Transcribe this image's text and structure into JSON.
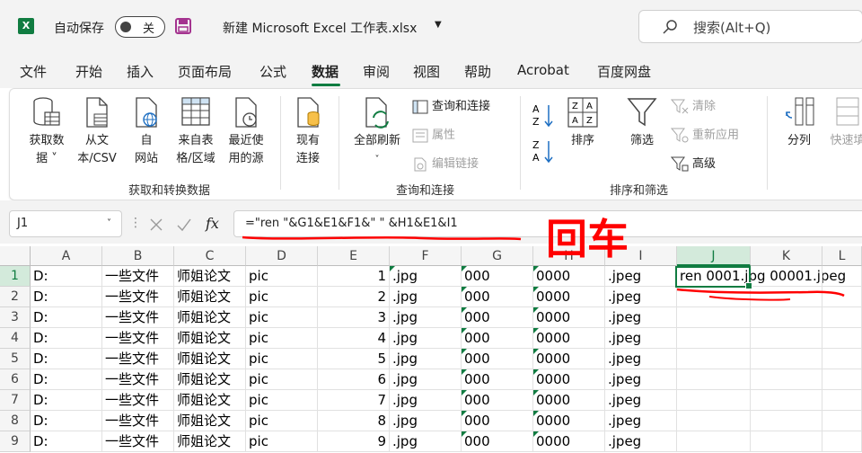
{
  "titlebar": {
    "app_logo": "X",
    "autosave_label": "自动保存",
    "autosave_state": "关",
    "save_icon": "save-icon",
    "doc_title": "新建 Microsoft Excel 工作表.xlsx",
    "search_placeholder": "搜索(Alt+Q)"
  },
  "tabs": [
    "文件",
    "开始",
    "插入",
    "页面布局",
    "公式",
    "数据",
    "审阅",
    "视图",
    "帮助",
    "Acrobat",
    "百度网盘"
  ],
  "active_tab": "数据",
  "ribbon": {
    "get_data": "获取数\n据 ˅",
    "from_text": "从文\n本/CSV",
    "from_web": "自\n网站",
    "from_table": "来自表\n格/区域",
    "recent_sources": "最近使\n用的源",
    "existing_conn": "现有\n连接",
    "group1_label": "获取和转换数据",
    "refresh_all": "全部刷新",
    "queries_conn": "查询和连接",
    "properties": "属性",
    "edit_links": "编辑链接",
    "group2_label": "查询和连接",
    "sort": "排序",
    "filter": "筛选",
    "clear": "清除",
    "reapply": "重新应用",
    "advanced": "高级",
    "group3_label": "排序和筛选",
    "split": "分列",
    "flash_fill": "快速填"
  },
  "formula_bar": {
    "name_box": "J1",
    "formula": "=\"ren \"&G1&E1&F1&\" \" &H1&E1&I1"
  },
  "grid": {
    "columns": [
      "A",
      "B",
      "C",
      "D",
      "E",
      "F",
      "G",
      "H",
      "I",
      "J",
      "K",
      "L"
    ],
    "selected_column": "J",
    "selected_row": 1,
    "rows": [
      {
        "n": "1",
        "A": "D:",
        "B": "一些文件",
        "C": "师姐论文",
        "D": "pic",
        "E": "1",
        "F": ".jpg",
        "G": "000",
        "H": "0000",
        "I": ".jpeg"
      },
      {
        "n": "2",
        "A": "D:",
        "B": "一些文件",
        "C": "师姐论文",
        "D": "pic",
        "E": "2",
        "F": ".jpg",
        "G": "000",
        "H": "0000",
        "I": ".jpeg"
      },
      {
        "n": "3",
        "A": "D:",
        "B": "一些文件",
        "C": "师姐论文",
        "D": "pic",
        "E": "3",
        "F": ".jpg",
        "G": "000",
        "H": "0000",
        "I": ".jpeg"
      },
      {
        "n": "4",
        "A": "D:",
        "B": "一些文件",
        "C": "师姐论文",
        "D": "pic",
        "E": "4",
        "F": ".jpg",
        "G": "000",
        "H": "0000",
        "I": ".jpeg"
      },
      {
        "n": "5",
        "A": "D:",
        "B": "一些文件",
        "C": "师姐论文",
        "D": "pic",
        "E": "5",
        "F": ".jpg",
        "G": "000",
        "H": "0000",
        "I": ".jpeg"
      },
      {
        "n": "6",
        "A": "D:",
        "B": "一些文件",
        "C": "师姐论文",
        "D": "pic",
        "E": "6",
        "F": ".jpg",
        "G": "000",
        "H": "0000",
        "I": ".jpeg"
      },
      {
        "n": "7",
        "A": "D:",
        "B": "一些文件",
        "C": "师姐论文",
        "D": "pic",
        "E": "7",
        "F": ".jpg",
        "G": "000",
        "H": "0000",
        "I": ".jpeg"
      },
      {
        "n": "8",
        "A": "D:",
        "B": "一些文件",
        "C": "师姐论文",
        "D": "pic",
        "E": "8",
        "F": ".jpg",
        "G": "000",
        "H": "0000",
        "I": ".jpeg"
      },
      {
        "n": "9",
        "A": "D:",
        "B": "一些文件",
        "C": "师姐论文",
        "D": "pic",
        "E": "9",
        "F": ".jpg",
        "G": "000",
        "H": "0000",
        "I": ".jpeg"
      }
    ],
    "J1_value": "ren 0001.jpg 00001.jpeg"
  },
  "annotation": {
    "text": "回车",
    "color": "#ff0000"
  },
  "colors": {
    "accent": "#107c41",
    "save_icon": "#a4338f"
  }
}
